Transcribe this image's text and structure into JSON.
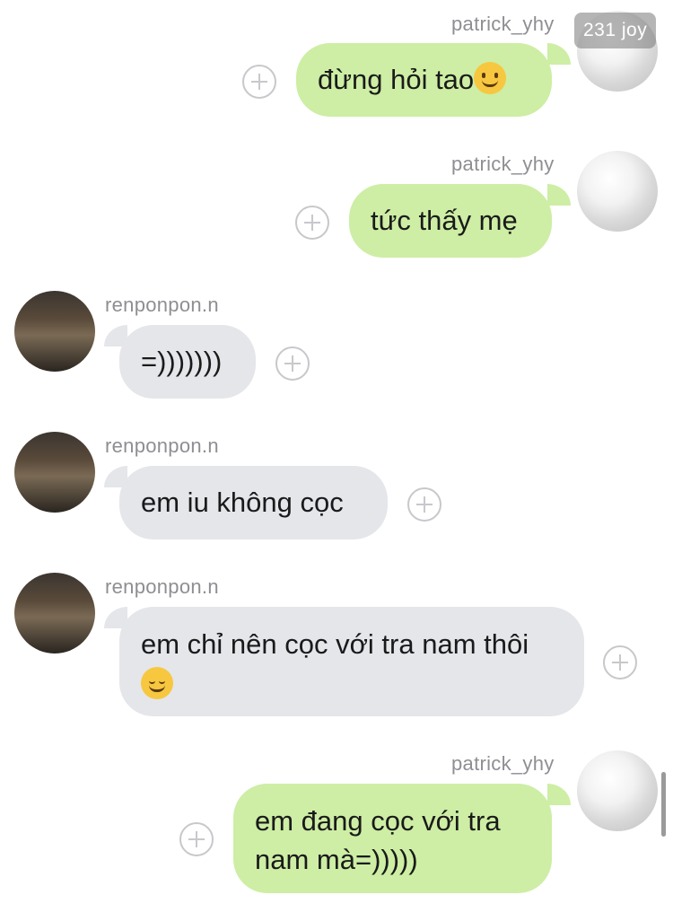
{
  "badge": {
    "text": "231 joy"
  },
  "messages": [
    {
      "sender": "patrick_yhy",
      "text": "đừng hỏi tao",
      "emoji": "slightly-smiling-face",
      "side": "out"
    },
    {
      "sender": "patrick_yhy",
      "text": "tức thấy mẹ",
      "side": "out"
    },
    {
      "sender": "renponpon.n",
      "text": "=)))))))",
      "side": "in"
    },
    {
      "sender": "renponpon.n",
      "text": "em iu không cọc",
      "side": "in"
    },
    {
      "sender": "renponpon.n",
      "text_line1": "em chỉ nên cọc với tra nam thôi",
      "emoji": "relieved-face",
      "side": "in"
    },
    {
      "sender": "patrick_yhy",
      "text_line1": "em đang cọc với tra",
      "text_line2": "nam mà=)))))",
      "side": "out"
    }
  ],
  "colors": {
    "outgoing_bubble": "#cdeea4",
    "incoming_bubble": "#e4e6ea",
    "sender_name": "#8e8e93"
  }
}
